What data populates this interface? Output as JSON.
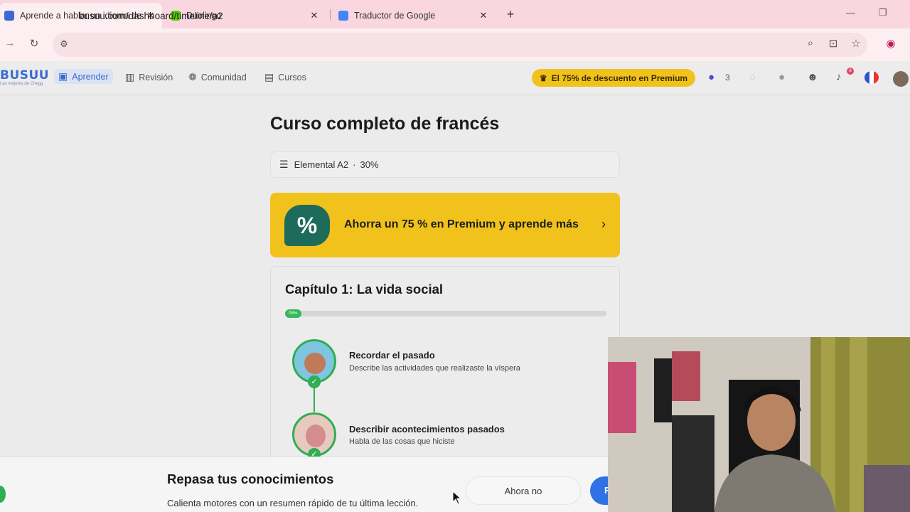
{
  "browser": {
    "tabs": [
      {
        "title": "Aprende a hablar un idioma de",
        "close": "✕",
        "color": "#3b6bd1",
        "active": true
      },
      {
        "title": "Duolingo",
        "close": "✕",
        "color": "#58cc02",
        "active": false
      },
      {
        "title": "Traductor de Google",
        "close": "✕",
        "color": "#4285f4",
        "active": false
      }
    ],
    "new_tab": "+",
    "minimize": "—",
    "restore": "❐",
    "url": "busuu.com/dashboard/timeline/a2"
  },
  "nav": {
    "logo": "BUSUU",
    "logo_tagline": "Las mejores de Chegg",
    "items": [
      {
        "label": "Aprender",
        "icon": "book-icon"
      },
      {
        "label": "Revisión",
        "icon": "bar-chart-icon"
      },
      {
        "label": "Comunidad",
        "icon": "people-icon"
      },
      {
        "label": "Cursos",
        "icon": "courses-icon"
      }
    ],
    "promo": "El 75% de descuento en Premium",
    "streak": "3",
    "notifications": "6"
  },
  "course": {
    "title": "Curso completo de francés",
    "level": "Elemental A2",
    "level_sep": "·",
    "level_progress": "30%"
  },
  "banner": {
    "badge": "%",
    "text": "Ahorra un 75 % en Premium y aprende más",
    "chevron": "›"
  },
  "chapter": {
    "title": "Capítulo 1: La vida social",
    "progress": 0.05,
    "progress_label": "05%",
    "lessons": [
      {
        "name": "Recordar el pasado",
        "desc": "Describe las actividades que realizaste la víspera",
        "done": true
      },
      {
        "name": "Describir acontecimientos pasados",
        "desc": "Habla de las cosas que hiciste",
        "done": true
      }
    ]
  },
  "sheet": {
    "title": "Repasa tus conocimientos",
    "subtitle": "Calienta motores con un resumen rápido de tu última lección.",
    "later": "Ahora no",
    "go": "R"
  },
  "colors": {
    "accent": "#3b6bd1",
    "promo": "#f1c21b",
    "success": "#2fae52",
    "primary_button": "#3072e6"
  }
}
